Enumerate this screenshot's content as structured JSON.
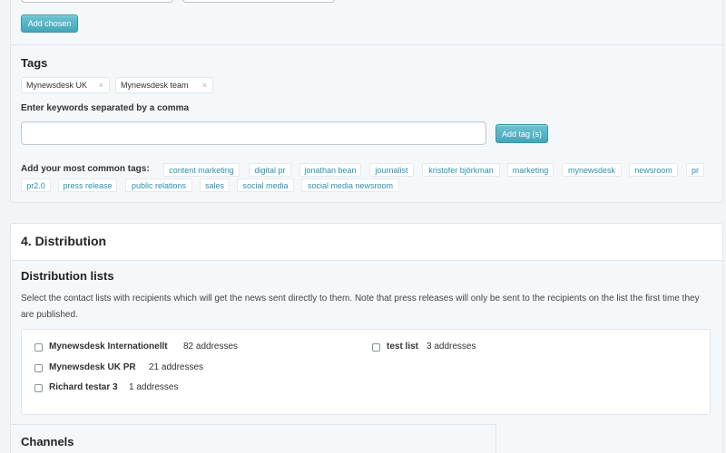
{
  "tags_section": {
    "add_chosen_label": "Add chosen",
    "heading": "Tags",
    "selected_tags": [
      {
        "label": "Mynewsdesk UK"
      },
      {
        "label": "Mynewsdesk team"
      }
    ],
    "remove_glyph": "×",
    "keywords_label": "Enter keywords separated by a comma",
    "keywords_value": "",
    "add_tag_label": "Add tag (s)",
    "common_label": "Add your most common tags:",
    "common_tags": [
      "content marketing",
      "digital pr",
      "jonathan bean",
      "journalist",
      "kristofer björkman",
      "marketing",
      "mynewsdesk",
      "newsroom",
      "pr",
      "pr2.0",
      "press release",
      "public relations",
      "sales",
      "social media",
      "social media newsroom"
    ]
  },
  "distribution": {
    "title": "4. Distribution",
    "lists_heading": "Distribution lists",
    "description": "Select the contact lists with recipients which will get the news sent directly to them. Note that press releases will only be sent to the recipients on the list the first time they are published.",
    "lists": [
      {
        "name": "Mynewsdesk Internationellt",
        "count": "82 addresses",
        "checked": false
      },
      {
        "name": "test list",
        "count": "3 addresses",
        "checked": false
      },
      {
        "name": "Mynewsdesk UK PR",
        "count": "21 addresses",
        "checked": false
      },
      {
        "name": "Richard testar 3",
        "count": "1 addresses",
        "checked": false
      }
    ],
    "channels_heading": "Channels"
  },
  "colors": {
    "accent": "#4aaabd",
    "tag_link": "#2c8fae",
    "panel_bg": "#f5f8fa"
  }
}
